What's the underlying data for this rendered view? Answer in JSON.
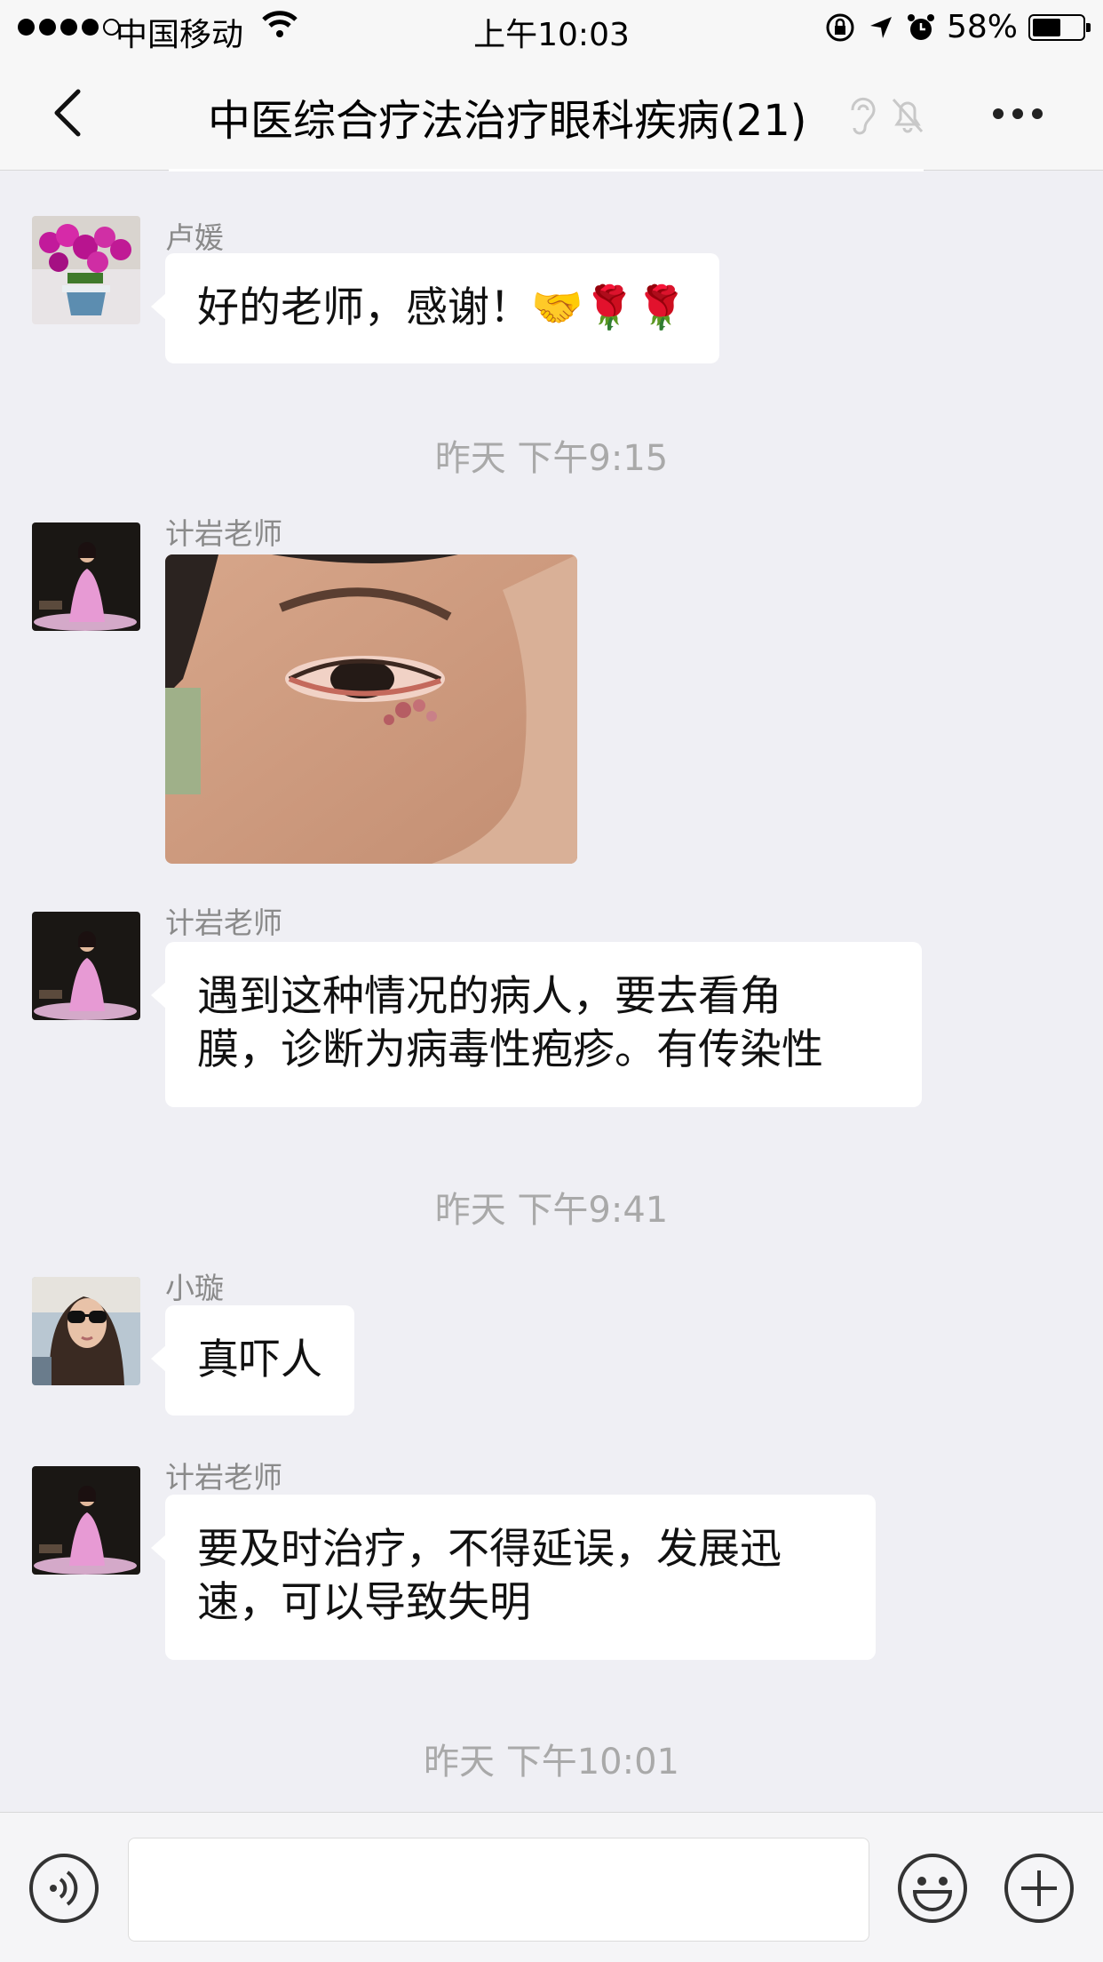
{
  "status_bar": {
    "carrier": "中国移动",
    "time": "上午10:03",
    "battery_percent": "58%",
    "battery_level": 0.58,
    "icons": [
      "signal-dots-icon",
      "wifi-icon",
      "orientation-lock-icon",
      "location-arrow-icon",
      "alarm-icon",
      "battery-icon"
    ]
  },
  "nav": {
    "title": "中医综合疗法治疗眼科疾病(21)",
    "icons": [
      "back-chevron-icon",
      "earpiece-icon",
      "mute-bell-icon",
      "more-dots-icon"
    ]
  },
  "messages": [
    {
      "type": "text",
      "sender": "卢媛",
      "text": "好的老师，感谢！🤝🌹🌹",
      "avatar": "orchid-flowers-photo"
    },
    {
      "type": "time",
      "text": "昨天 下午9:15"
    },
    {
      "type": "image",
      "sender": "计岩老师",
      "avatar": "woman-in-pink-dress-photo",
      "image": "eye-closeup-photo"
    },
    {
      "type": "text",
      "sender": "计岩老师",
      "avatar": "woman-in-pink-dress-photo",
      "lines": [
        "遇到这种情况的病人，要去看角",
        "膜，诊断为病毒性疱疹。有传染性"
      ]
    },
    {
      "type": "time",
      "text": "昨天 下午9:41"
    },
    {
      "type": "text",
      "sender": "小璇",
      "avatar": "woman-with-sunglasses-photo",
      "text": "真吓人"
    },
    {
      "type": "text",
      "sender": "计岩老师",
      "avatar": "woman-in-pink-dress-photo",
      "lines": [
        "要及时治疗，不得延误，发展迅",
        "速，可以导致失明"
      ]
    },
    {
      "type": "time",
      "text": "昨天 下午10:01"
    }
  ],
  "input_bar": {
    "value": "",
    "icons": [
      "voice-input-icon",
      "emoji-icon",
      "add-plus-icon"
    ]
  }
}
